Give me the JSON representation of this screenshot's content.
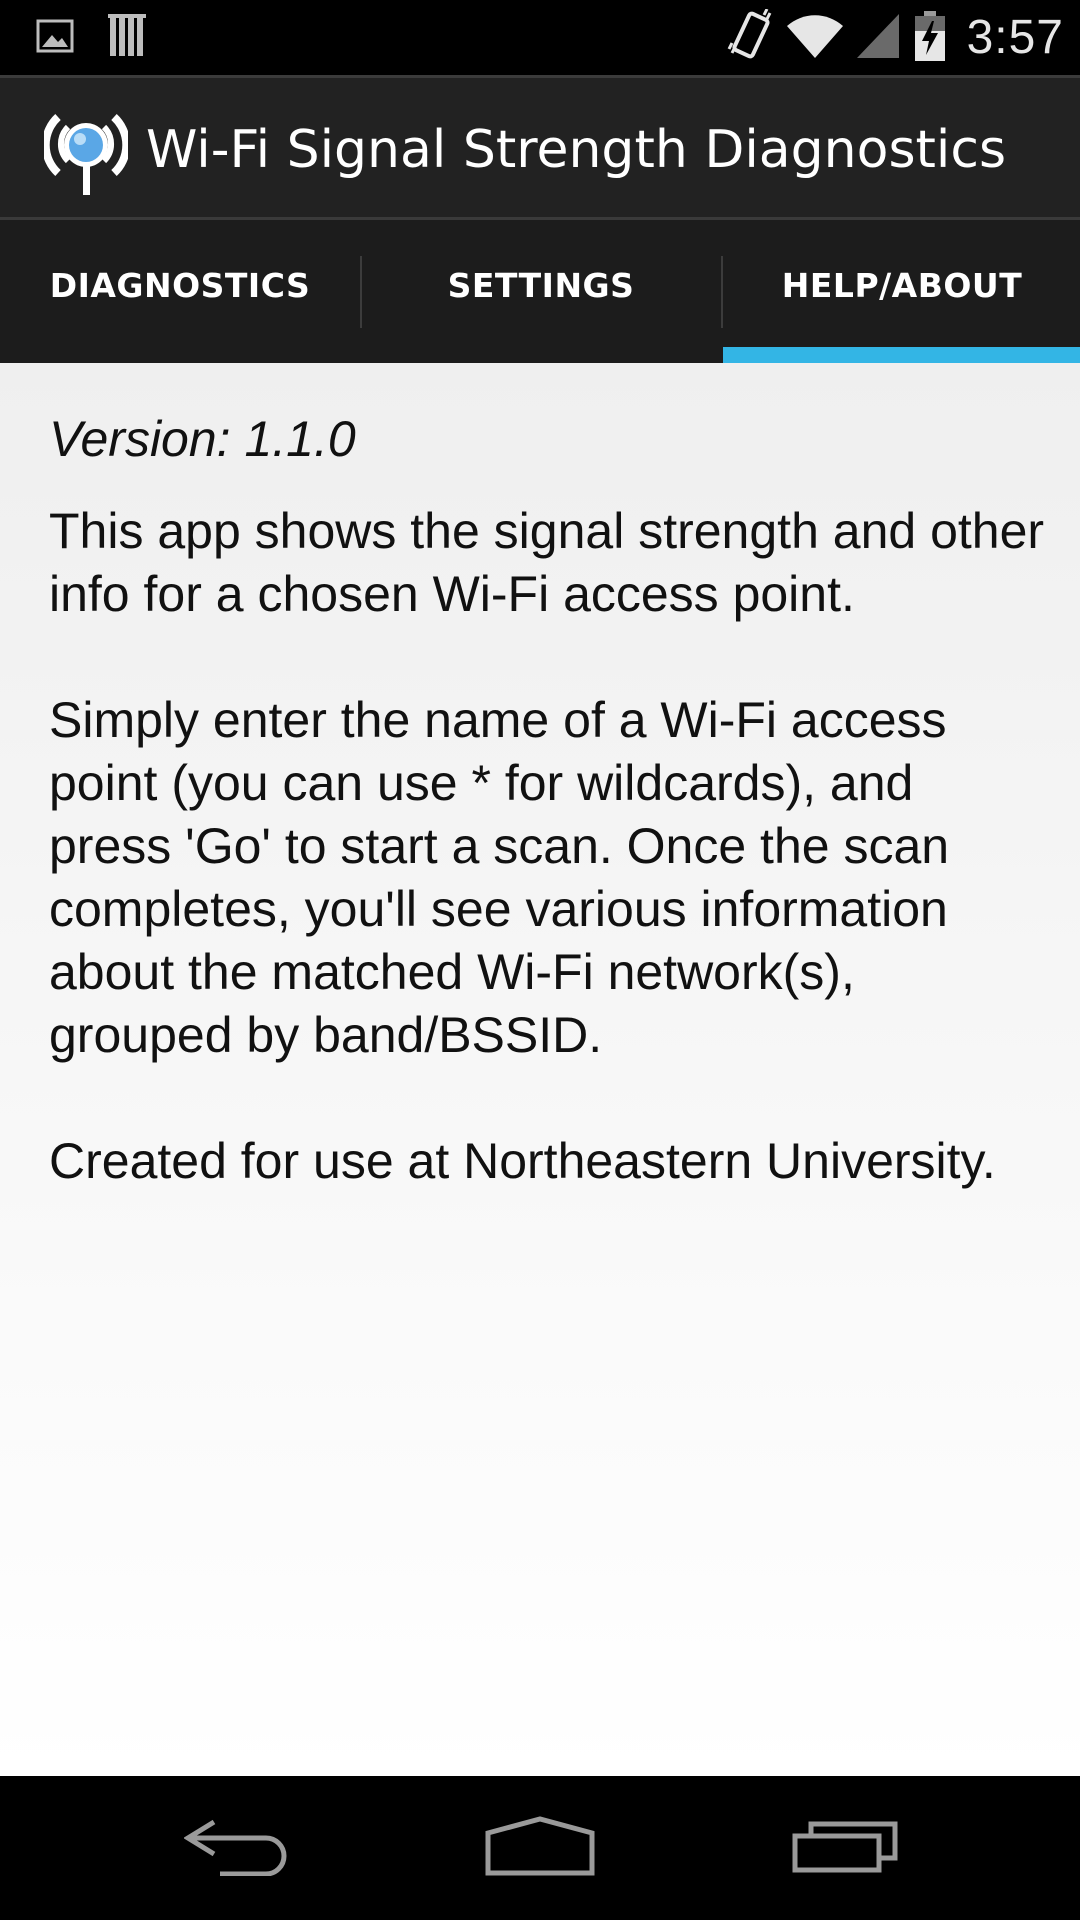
{
  "status_bar": {
    "time": "3:57",
    "icons": [
      "picture-icon",
      "barcode-icon",
      "vibrate-icon",
      "wifi-icon",
      "signal-icon",
      "battery-charging-icon"
    ]
  },
  "action_bar": {
    "title": "Wi-Fi Signal Strength Diagnostics",
    "icon": "wifi-search-icon"
  },
  "tabs": [
    {
      "label": "DIAGNOSTICS",
      "selected": false
    },
    {
      "label": "SETTINGS",
      "selected": false
    },
    {
      "label": "HELP/ABOUT",
      "selected": true
    }
  ],
  "accent_color": "#33b5e5",
  "content": {
    "version": "Version: 1.1.0",
    "paragraphs": [
      "This app shows the signal strength and other info for a chosen Wi-Fi access point.",
      "Simply enter the name of a Wi-Fi access point (you can use * for wildcards), and press 'Go' to start a scan. Once the scan completes, you'll see various information about the matched Wi-Fi network(s), grouped by band/BSSID.",
      "Created for use at Northeastern University."
    ]
  },
  "nav_bar": {
    "buttons": [
      "back-icon",
      "home-icon",
      "recents-icon"
    ]
  }
}
